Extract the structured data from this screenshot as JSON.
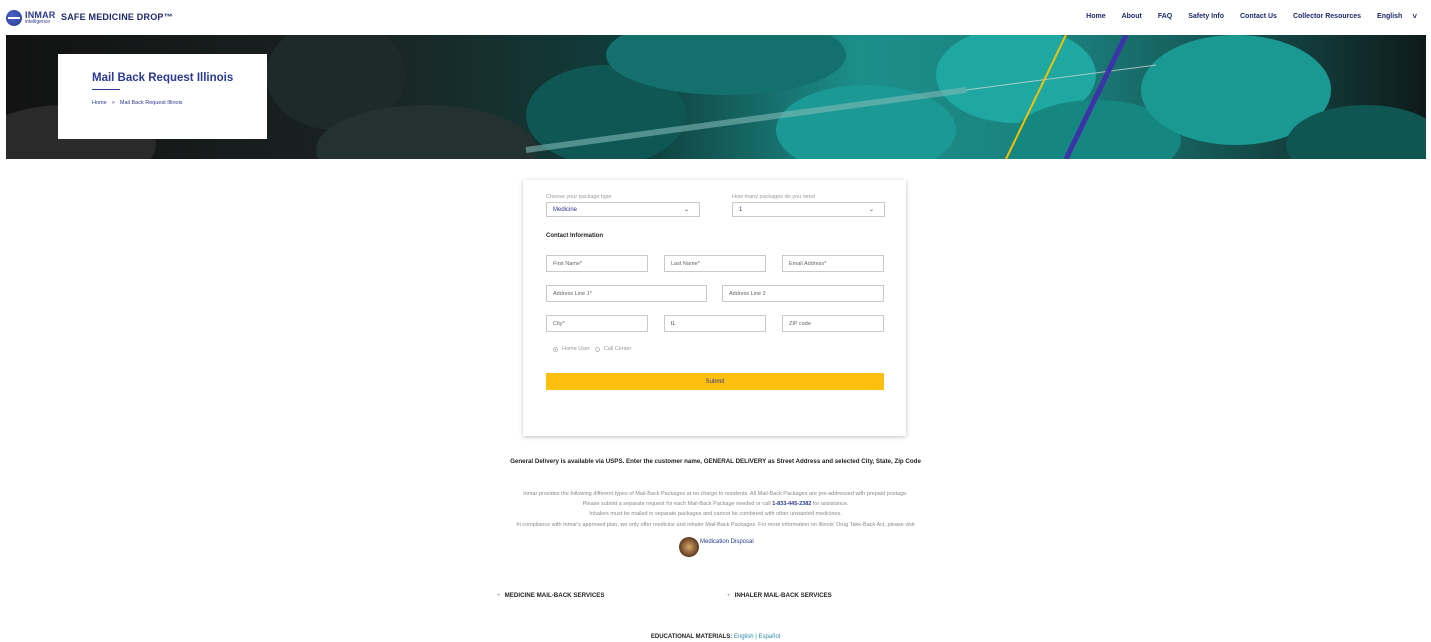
{
  "header": {
    "logo_word": "INMAR",
    "logo_sub": "intelligence",
    "brand": "SAFE MEDICINE DROP™",
    "nav": [
      "Home",
      "About",
      "FAQ",
      "Safety Info",
      "Contact Us",
      "Collector Resources",
      "English"
    ]
  },
  "hero": {
    "title": "Mail Back Request Illinois",
    "breadcrumb": {
      "home": "Home",
      "separator": ">",
      "current": "Mail Back Request Illinois"
    }
  },
  "form": {
    "package_type_label": "Choose your package type",
    "package_type_value": "Medicine",
    "quantity_label": "How many packages do you need",
    "quantity_value": "1",
    "section_title": "Contact Information",
    "first_name_placeholder": "First Name*",
    "last_name_placeholder": "Last Name*",
    "email_placeholder": "Email Address*",
    "address1_placeholder": "Address Line 1*",
    "address2_placeholder": "Address Line 2",
    "city_placeholder": "City*",
    "state_value": "IL",
    "zip_placeholder": "ZIP code",
    "radio_home": "Home User",
    "radio_call": "Call Center",
    "submit_label": "Submit"
  },
  "notice": "General Delivery is available via USPS. Enter the customer name, GENERAL DELIVERY as Street Address and selected City, State, Zip Code",
  "info": {
    "line1": "Inmar provides the following different types of Mail-Back Packages at no charge to residents. All Mail-Back Packages are pre-addressed with prepaid postage.",
    "line2_pre": "Please submit a separate request for each Mail-Back Package needed or call ",
    "phone": "1-833-445-2382",
    "line2_post": " for assistance.",
    "line3": "Inhalers must be mailed in separate packages and cannot be combined with other unwanted medicines.",
    "line4": "In compliance with Inmar's approved plan, we only offer medicine and inhaler Mail-Back Packages. For more information on Illinois' Drug Take-Back Act, please visit",
    "link": "Medication Disposal"
  },
  "services": {
    "medicine": "MEDICINE MAIL-BACK SERVICES",
    "inhaler": "INHALER MAIL-BACK SERVICES"
  },
  "education": {
    "title": "EDUCATIONAL MATERIALS:",
    "english": "English",
    "separator": "|",
    "spanish": "Español"
  },
  "colors": {
    "brand_blue": "#2a3a8f",
    "accent_yellow": "#ffbf0f",
    "hero_teal": "#1c8f8b"
  }
}
